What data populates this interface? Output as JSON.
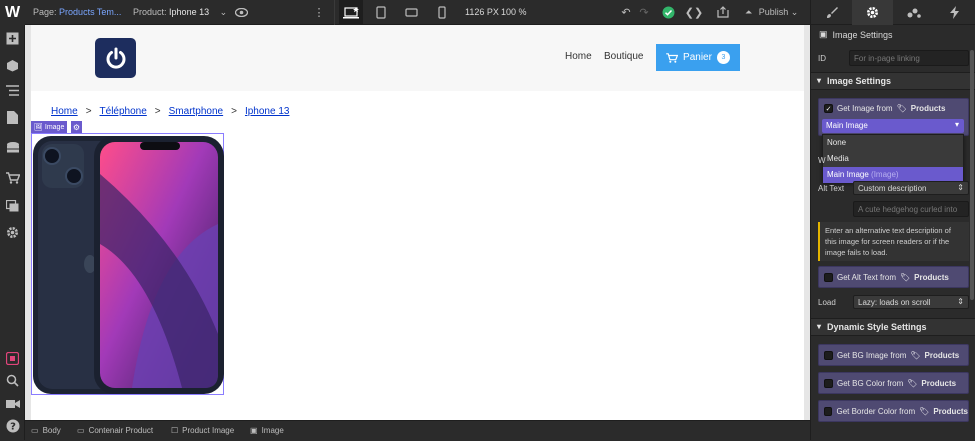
{
  "topbar": {
    "page_label": "Page:",
    "page_name": "Products Tem...",
    "product_label": "Product:",
    "product_name": "Iphone 13",
    "width": "1126 PX",
    "zoom": "100 %",
    "publish_label": "Publish"
  },
  "site": {
    "nav": [
      "Home",
      "Boutique"
    ],
    "cart_label": "Panier",
    "cart_count": "3"
  },
  "breadcrumb": [
    "Home",
    "Téléphone",
    "Smartphone",
    "Iphone 13"
  ],
  "breadcrumb_sep": ">",
  "image_tag": "Image",
  "bottom_breadcrumb": [
    "Body",
    "Contenair Product",
    "Product Image",
    "Image"
  ],
  "panel": {
    "title": "Image Settings",
    "id_label": "ID",
    "id_placeholder": "For in-page linking",
    "section_image": "Image Settings",
    "get_image_from": "Get Image from",
    "collection": "Products",
    "dropdown_selected": "Main Image",
    "dropdown_options": [
      "None",
      "Media",
      "Main Image"
    ],
    "dropdown_hint": "(Image)",
    "partial_label": "W",
    "alt_label": "Alt Text",
    "alt_value": "Custom description",
    "alt_placeholder": "A cute hedgehog curled into",
    "note": "Enter an alternative text description of this image for screen readers or if the image fails to load.",
    "get_alt_from": "Get Alt Text from",
    "load_label": "Load",
    "load_value": "Lazy: loads on scroll",
    "section_dynamic": "Dynamic Style Settings",
    "get_bg_image": "Get BG Image from",
    "get_bg_color": "Get BG Color from",
    "get_border_color": "Get Border Color from"
  },
  "colors": {
    "accent": "#6a5acd",
    "cart": "#3aa0ef",
    "logo_bg": "#1d2d5e",
    "link": "#0033cc"
  }
}
